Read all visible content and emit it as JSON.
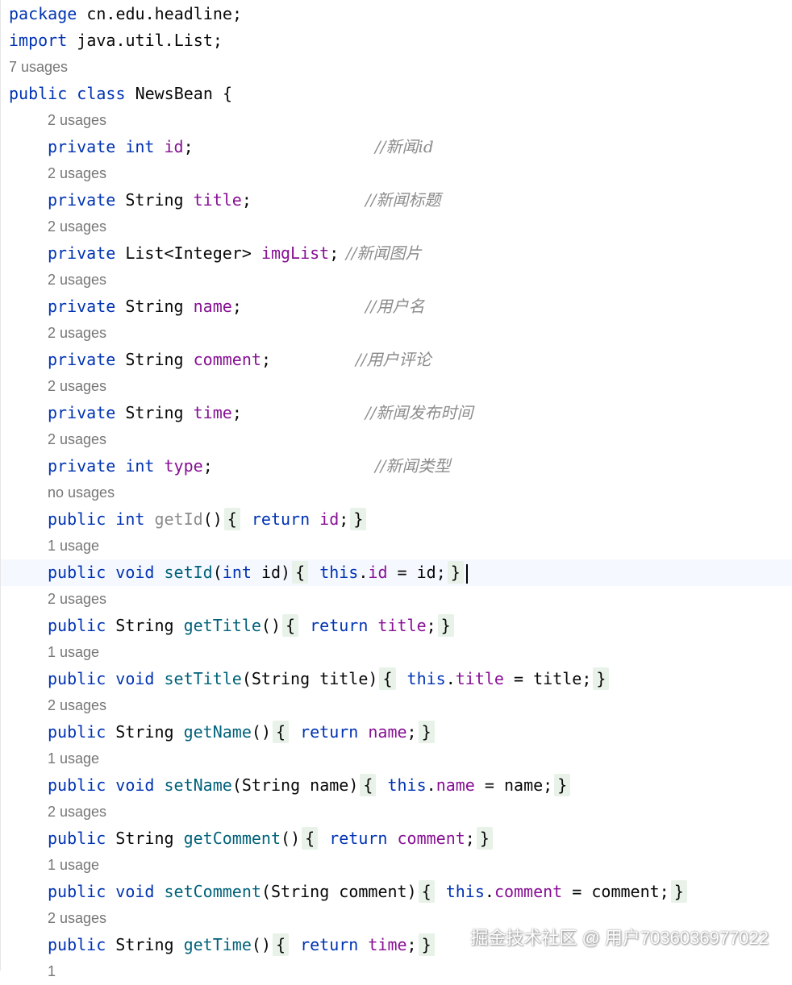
{
  "editor": {
    "package_line": {
      "keyword": "package",
      "name": "cn.edu.headline;"
    },
    "import_line": {
      "keyword": "import",
      "name": "java.util.List;"
    },
    "class_usages": "7 usages",
    "class_line": {
      "mod": "public",
      "kw": "class",
      "name": "NewsBean",
      "brace": "{"
    },
    "fields": [
      {
        "usages": "2 usages",
        "mod": "private",
        "type": "int",
        "type_is_kw": true,
        "name": "id",
        "comment": "//新闻id"
      },
      {
        "usages": "2 usages",
        "mod": "private",
        "type": "String",
        "type_is_kw": false,
        "name": "title",
        "comment": "//新闻标题"
      },
      {
        "usages": "2 usages",
        "mod": "private",
        "type": "List<Integer>",
        "type_is_kw": false,
        "name": "imgList",
        "comment": "//新闻图片"
      },
      {
        "usages": "2 usages",
        "mod": "private",
        "type": "String",
        "type_is_kw": false,
        "name": "name",
        "comment": "//用户名"
      },
      {
        "usages": "2 usages",
        "mod": "private",
        "type": "String",
        "type_is_kw": false,
        "name": "comment",
        "comment": "//用户评论"
      },
      {
        "usages": "2 usages",
        "mod": "private",
        "type": "String",
        "type_is_kw": false,
        "name": "time",
        "comment": "//新闻发布时间"
      },
      {
        "usages": "2 usages",
        "mod": "private",
        "type": "int",
        "type_is_kw": true,
        "name": "type",
        "comment": "//新闻类型"
      }
    ],
    "methods": [
      {
        "usages": "no usages",
        "mod": "public",
        "ret": "int",
        "name": "getId",
        "kind": "get",
        "field": "id",
        "unused": true
      },
      {
        "usages": "1 usage",
        "mod": "public",
        "ret": "void",
        "name": "setId",
        "kind": "set",
        "ptype": "int",
        "param": "id",
        "field": "id",
        "current": true
      },
      {
        "usages": "2 usages",
        "mod": "public",
        "ret": "String",
        "name": "getTitle",
        "kind": "get",
        "field": "title"
      },
      {
        "usages": "1 usage",
        "mod": "public",
        "ret": "void",
        "name": "setTitle",
        "kind": "set",
        "ptype": "String",
        "param": "title",
        "field": "title"
      },
      {
        "usages": "2 usages",
        "mod": "public",
        "ret": "String",
        "name": "getName",
        "kind": "get",
        "field": "name"
      },
      {
        "usages": "1 usage",
        "mod": "public",
        "ret": "void",
        "name": "setName",
        "kind": "set",
        "ptype": "String",
        "param": "name",
        "field": "name"
      },
      {
        "usages": "2 usages",
        "mod": "public",
        "ret": "String",
        "name": "getComment",
        "kind": "get",
        "field": "comment"
      },
      {
        "usages": "1 usage",
        "mod": "public",
        "ret": "void",
        "name": "setComment",
        "kind": "set",
        "ptype": "String",
        "param": "comment",
        "field": "comment"
      },
      {
        "usages": "2 usages",
        "mod": "public",
        "ret": "String",
        "name": "getTime",
        "kind": "get",
        "field": "time"
      }
    ],
    "trailing_usages": "1"
  },
  "watermark": "掘金技术社区 @ 用户7036036977022",
  "colors": {
    "keyword": "#0033b3",
    "field": "#871094",
    "method": "#00627a",
    "comment": "#8c8c8c",
    "inlay_hint": "#767676",
    "brace_highlight": "#e8f2e8",
    "current_line": "#f5f8fe"
  }
}
